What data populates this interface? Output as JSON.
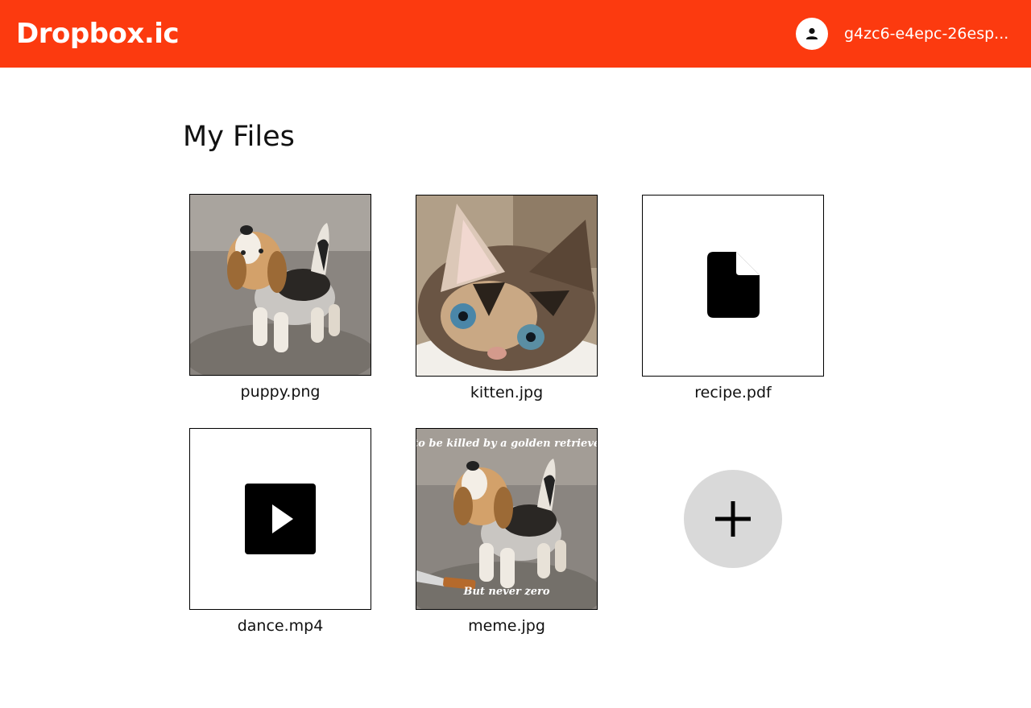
{
  "header": {
    "brand": "Dropbox.ic",
    "username": "g4zc6-e4epc-26esp...",
    "avatar_icon": "person-icon",
    "color": "#fc3a0f"
  },
  "main": {
    "title": "My Files",
    "files": [
      {
        "name": "puppy.png",
        "kind": "image",
        "thumbnail": "puppy-photo"
      },
      {
        "name": "kitten.jpg",
        "kind": "image",
        "thumbnail": "kitten-photo"
      },
      {
        "name": "recipe.pdf",
        "kind": "document",
        "icon": "document-icon"
      },
      {
        "name": "dance.mp4",
        "kind": "video",
        "icon": "play-icon"
      },
      {
        "name": "meme.jpg",
        "kind": "image",
        "thumbnail": "puppy-meme-photo",
        "caption_top": "es to be killed by a golden retriever a",
        "caption_bottom": "But never zero"
      }
    ],
    "add_button": {
      "icon": "plus-icon",
      "color": "#d9d9d9"
    }
  }
}
